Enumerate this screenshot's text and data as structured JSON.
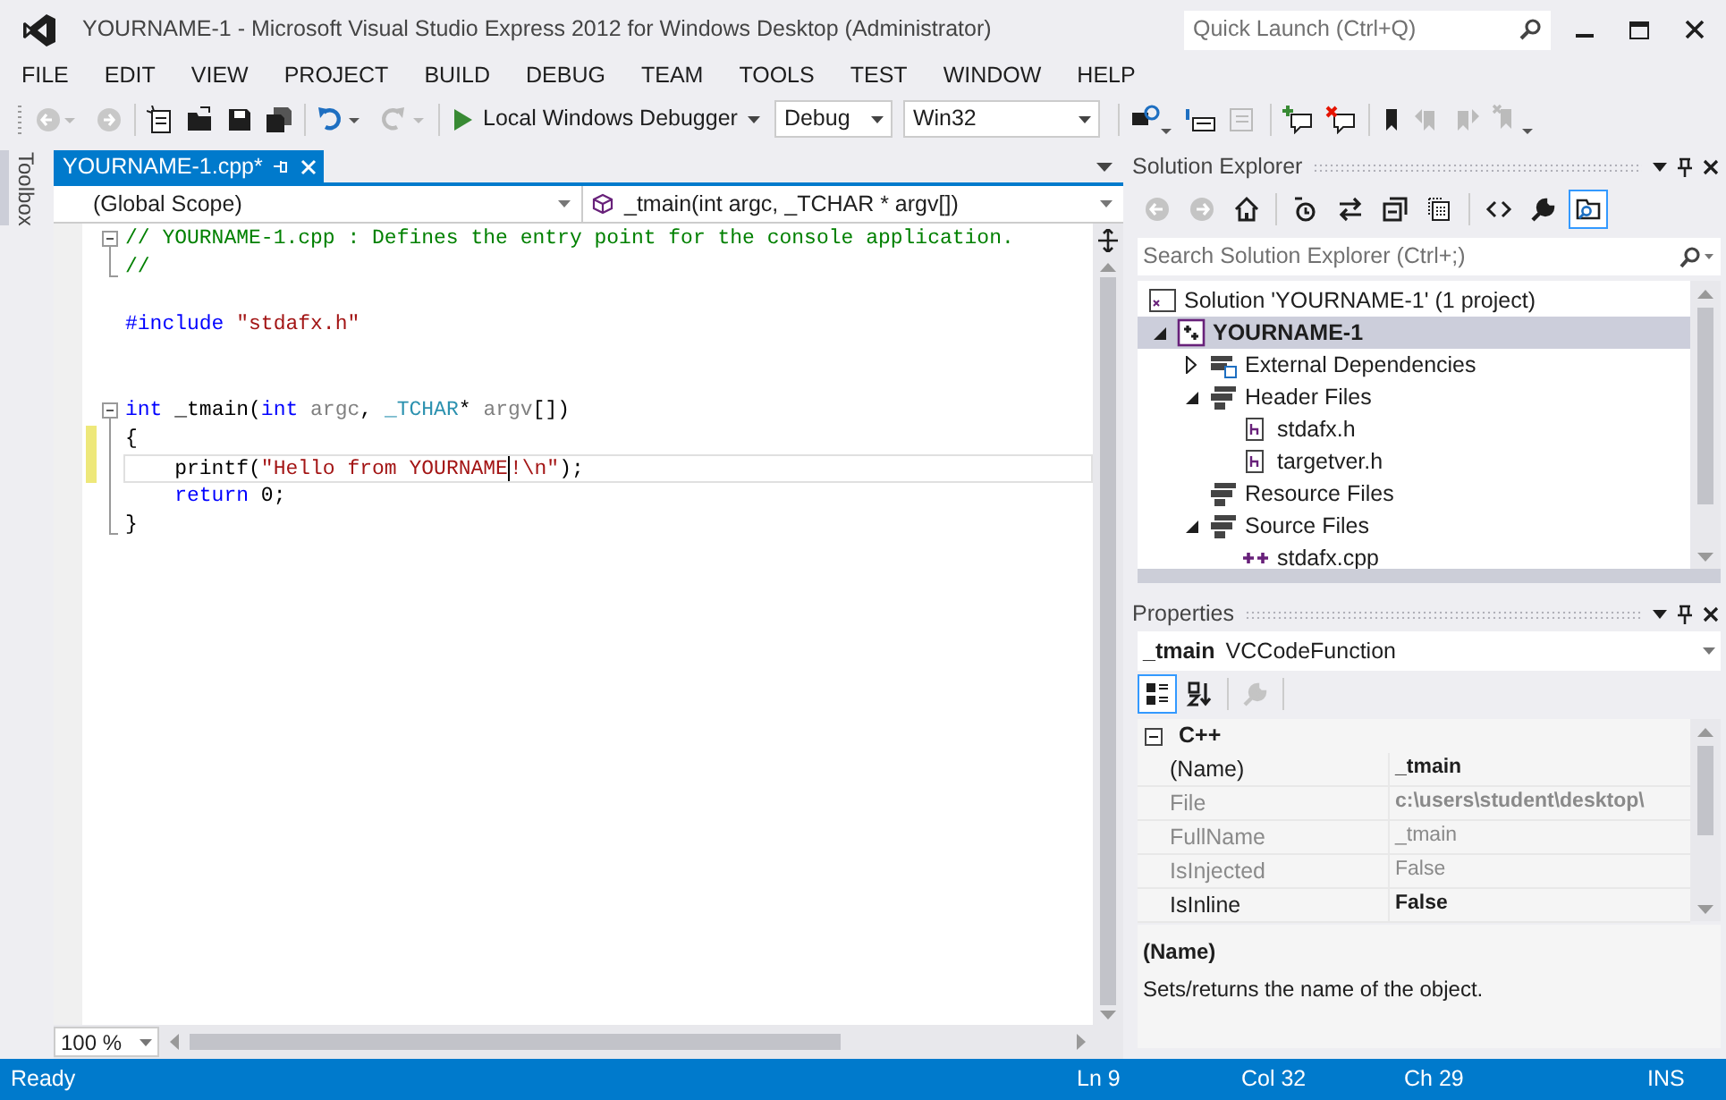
{
  "window": {
    "title": "YOURNAME-1 - Microsoft Visual Studio Express 2012 for Windows Desktop (Administrator)",
    "quick_launch": {
      "placeholder": "Quick Launch (Ctrl+Q)"
    }
  },
  "menu": [
    "FILE",
    "EDIT",
    "VIEW",
    "PROJECT",
    "BUILD",
    "DEBUG",
    "TEAM",
    "TOOLS",
    "TEST",
    "WINDOW",
    "HELP"
  ],
  "toolbar": {
    "start_button": "Local Windows Debugger",
    "configuration": "Debug",
    "platform": "Win32"
  },
  "toolbox_tab": "Toolbox",
  "editor": {
    "tabs": [
      {
        "label": "YOURNAME-1.cpp*",
        "selected": true
      }
    ],
    "scope": "(Global Scope)",
    "member": "_tmain(int argc, _TCHAR * argv[])",
    "lines": [
      {
        "kind": "fold-start",
        "changed": false,
        "current": false,
        "tokens": [
          {
            "kind": "comment",
            "text": "// YOURNAME-1.cpp : Defines the entry point for the console application."
          }
        ]
      },
      {
        "kind": "fold-end",
        "changed": false,
        "current": false,
        "tokens": [
          {
            "kind": "comment",
            "text": "//"
          }
        ]
      },
      {
        "kind": "plain",
        "changed": false,
        "current": false
      },
      {
        "kind": "plain",
        "changed": false,
        "current": false,
        "tokens": [
          {
            "kind": "keyword",
            "text": "#include "
          },
          {
            "kind": "string",
            "text": "\"stdafx.h\""
          }
        ]
      },
      {
        "kind": "plain",
        "changed": false,
        "current": false
      },
      {
        "kind": "plain",
        "changed": false,
        "current": false
      },
      {
        "kind": "fold-start",
        "changed": false,
        "current": false,
        "tokens": [
          {
            "kind": "keyword",
            "text": "int "
          },
          {
            "kind": "plain",
            "text": "_tmain("
          },
          {
            "kind": "keyword",
            "text": "int "
          },
          {
            "kind": "param",
            "text": "argc"
          },
          {
            "kind": "plain",
            "text": ", "
          },
          {
            "kind": "type",
            "text": "_TCHAR"
          },
          {
            "kind": "plain",
            "text": "* "
          },
          {
            "kind": "param",
            "text": "argv"
          },
          {
            "kind": "plain",
            "text": "[])"
          }
        ]
      },
      {
        "kind": "fold-body",
        "changed": true,
        "current": false,
        "tokens": [
          {
            "kind": "plain",
            "text": "{"
          }
        ]
      },
      {
        "kind": "fold-body",
        "changed": true,
        "current": true,
        "tokens": [
          {
            "kind": "plain",
            "text": "    printf("
          },
          {
            "kind": "string",
            "text": "\"Hello from YOURNAME"
          },
          {
            "kind": "caret"
          },
          {
            "kind": "string",
            "text": "!\\n\""
          },
          {
            "kind": "plain",
            "text": ");"
          }
        ]
      },
      {
        "kind": "fold-body",
        "changed": false,
        "current": false,
        "tokens": [
          {
            "kind": "keyword",
            "text": "    return"
          },
          {
            "kind": "plain",
            "text": " 0;"
          }
        ]
      },
      {
        "kind": "fold-end",
        "changed": false,
        "current": false,
        "tokens": [
          {
            "kind": "plain",
            "text": "}"
          }
        ]
      }
    ],
    "zoom": "100 %"
  },
  "solution_explorer": {
    "title": "Solution Explorer",
    "search": {
      "placeholder": "Search Solution Explorer (Ctrl+;)"
    },
    "toolbar": [
      {
        "kind": "back",
        "selected": false,
        "disabled": true
      },
      {
        "kind": "forward",
        "selected": false,
        "disabled": true
      },
      {
        "kind": "home",
        "selected": false,
        "disabled": false
      },
      {
        "kind": "pending",
        "selected": false,
        "disabled": false
      },
      {
        "kind": "sync",
        "selected": false,
        "disabled": false
      },
      {
        "kind": "collapse",
        "selected": false,
        "disabled": false
      },
      {
        "kind": "show-all",
        "selected": false,
        "disabled": false
      },
      {
        "kind": "code",
        "selected": false,
        "disabled": false
      },
      {
        "kind": "properties",
        "selected": false,
        "disabled": false
      },
      {
        "kind": "preview",
        "selected": true,
        "disabled": false
      }
    ],
    "tree": [
      {
        "label": "Solution 'YOURNAME-1' (1 project)",
        "kind": "solution",
        "selected": false,
        "children": [
          {
            "label": "YOURNAME-1",
            "kind": "project",
            "expanded": true,
            "selected": true,
            "children": [
              {
                "label": "External Dependencies",
                "kind": "external",
                "expanded": false,
                "selected": false
              },
              {
                "label": "Header Files",
                "kind": "folder",
                "expanded": true,
                "selected": false,
                "children": [
                  {
                    "label": "stdafx.h",
                    "kind": "header",
                    "selected": false
                  },
                  {
                    "label": "targetver.h",
                    "kind": "header",
                    "selected": false
                  }
                ]
              },
              {
                "label": "Resource Files",
                "kind": "folder",
                "selected": false
              },
              {
                "label": "Source Files",
                "kind": "folder",
                "expanded": true,
                "selected": false,
                "children": [
                  {
                    "label": "stdafx.cpp",
                    "kind": "source",
                    "selected": false
                  }
                ]
              }
            ]
          }
        ]
      }
    ]
  },
  "properties": {
    "title": "Properties",
    "object_name": "_tmain",
    "object_type": "VCCodeFunction",
    "toolbar": [
      {
        "kind": "categorized",
        "selected": true,
        "disabled": false
      },
      {
        "kind": "alphabetical",
        "selected": false,
        "disabled": false
      },
      {
        "kind": "property-pages",
        "selected": false,
        "disabled": true
      }
    ],
    "category": {
      "label": "C++",
      "expanded": true
    },
    "rows": [
      {
        "name": "(Name)",
        "value": "_tmain",
        "readonly": false,
        "value_bold": true
      },
      {
        "name": "File",
        "value": "c:\\users\\student\\desktop\\",
        "readonly": true,
        "value_bold": true
      },
      {
        "name": "FullName",
        "value": "_tmain",
        "readonly": true,
        "value_bold": false
      },
      {
        "name": "IsInjected",
        "value": "False",
        "readonly": true,
        "value_bold": false
      },
      {
        "name": "IsInline",
        "value": "False",
        "readonly": false,
        "value_bold": true
      }
    ],
    "description": {
      "title": "(Name)",
      "text": "Sets/returns the name of the object."
    }
  },
  "status_bar": {
    "message": "Ready",
    "line": "Ln 9",
    "column": "Col 32",
    "char": "Ch 29",
    "mode": "INS"
  }
}
